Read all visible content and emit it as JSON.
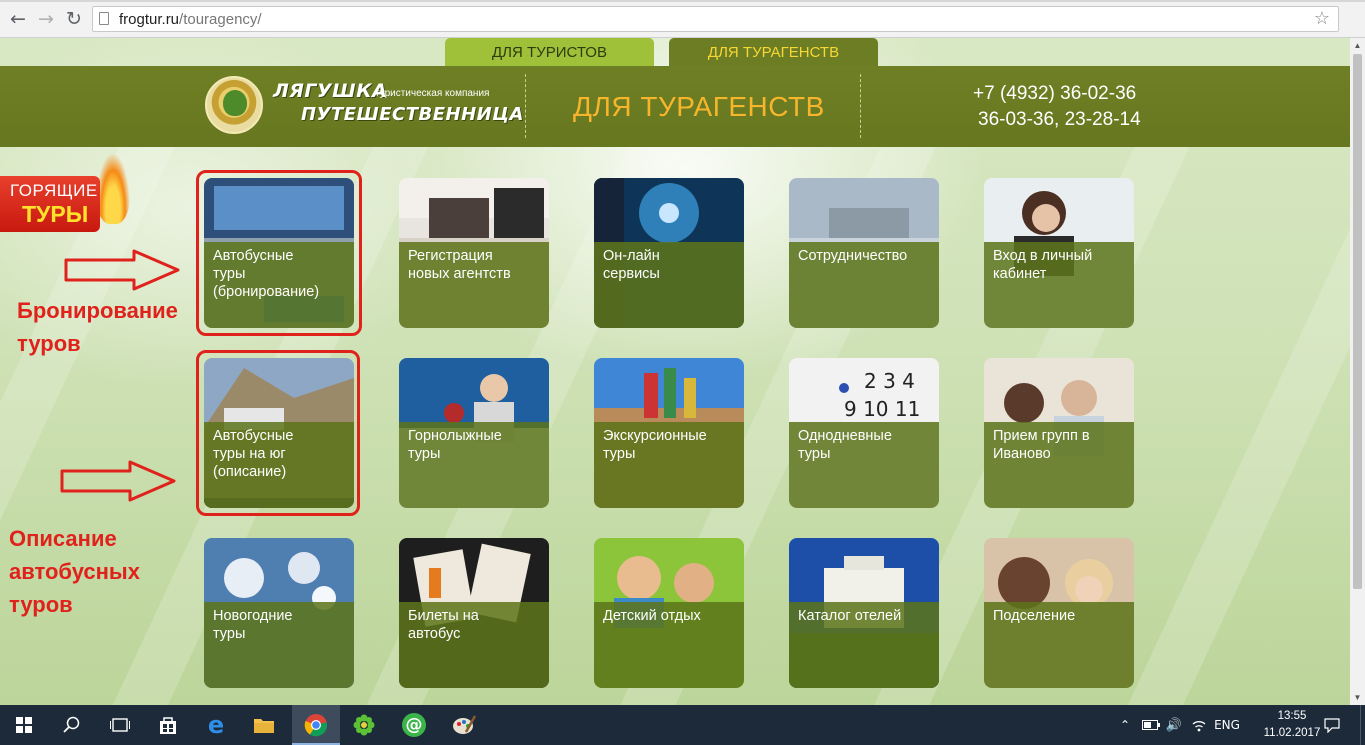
{
  "browser": {
    "url_host": "frogtur.ru",
    "url_path": "/touragency/",
    "icons": {
      "back": "back-arrow-icon",
      "forward": "forward-arrow-icon",
      "reload": "reload-icon",
      "bookmark": "star-icon"
    }
  },
  "site_tabs": {
    "tourists": "ДЛЯ ТУРИСТОВ",
    "agencies": "ДЛЯ ТУРАГЕНСТВ"
  },
  "header": {
    "logo_line1": "ЛЯГУШКА",
    "logo_line2": "ПУТЕШЕСТВЕННИЦА",
    "logo_subtitle": "туристическая компания",
    "title": "ДЛЯ ТУРАГЕНСТВ",
    "phone1": "+7 (4932) 36-02-36",
    "phone2": "36-03-36, 23-28-14"
  },
  "hot_tours": {
    "line1": "ГОРЯЩИЕ",
    "line2": "ТУРЫ"
  },
  "annotations": {
    "booking": "Бронирование\nтуров",
    "description": "Описание\nавтобусных\nтуров",
    "color": "#e0221c"
  },
  "tiles": [
    {
      "label": "Автобусные\nтуры\n(бронирование)"
    },
    {
      "label": "Регистрация\nновых агентств"
    },
    {
      "label": "Он-лайн\nсервисы"
    },
    {
      "label": "Сотрудничество"
    },
    {
      "label": "Вход в личный\nкабинет"
    },
    {
      "label": "Автобусные\nтуры на юг\n(описание)"
    },
    {
      "label": "Горнолыжные\nтуры"
    },
    {
      "label": "Экскурсионные\nтуры"
    },
    {
      "label": "Однодневные\nтуры"
    },
    {
      "label": "Прием групп в\nИваново"
    },
    {
      "label": "Новогодние\nтуры"
    },
    {
      "label": "Билеты на\nавтобус"
    },
    {
      "label": "Детский отдых"
    },
    {
      "label": "Каталог отелей"
    },
    {
      "label": "Подселение"
    }
  ],
  "taskbar": {
    "language": "ENG",
    "time": "13:55",
    "date": "11.02.2017",
    "icons": [
      "windows-start-icon",
      "search-icon",
      "task-view-icon",
      "store-icon",
      "edge-icon",
      "file-explorer-icon",
      "chrome-icon",
      "icq-icon",
      "mail-agent-icon",
      "paint-icon"
    ]
  },
  "colors": {
    "header_green": "#6f7f25",
    "tab_tourists": "#9fc13a",
    "tab_agencies_text": "#f7d733",
    "title_orange": "#f7b52b",
    "tile_overlay": "#5c741a"
  }
}
